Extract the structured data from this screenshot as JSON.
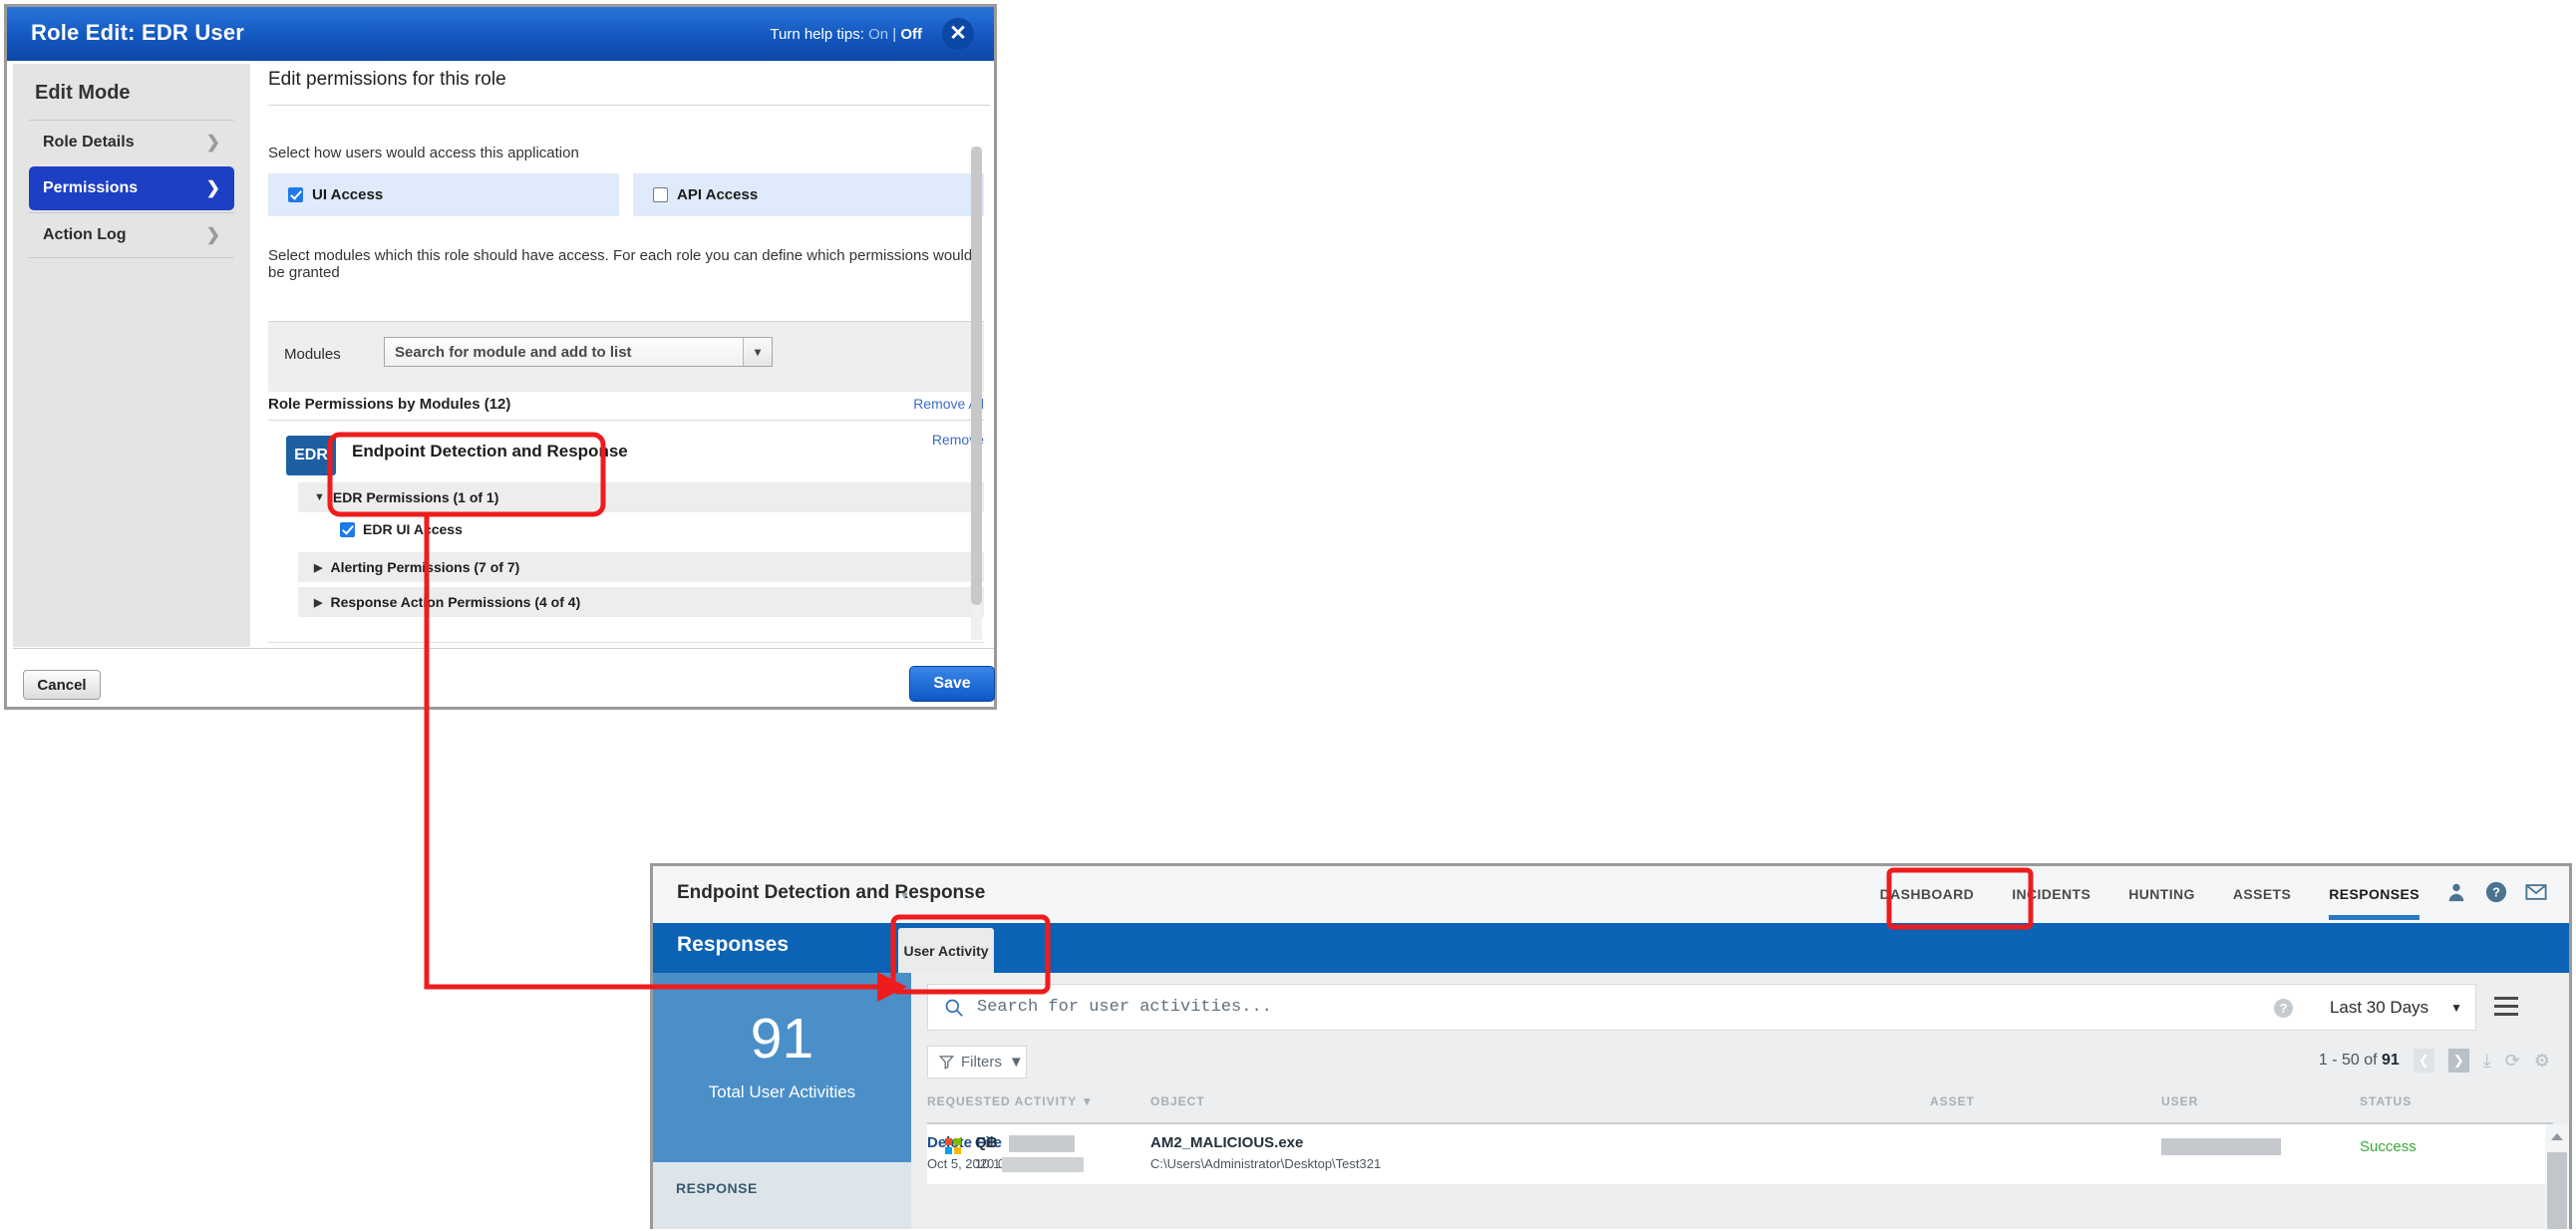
{
  "role_window": {
    "title": "Role Edit: EDR User",
    "help_tips": {
      "label": "Turn help tips:",
      "on": "On",
      "separator": "|",
      "off": "Off"
    },
    "close_icon": "close-icon",
    "sidebar": {
      "heading": "Edit Mode",
      "items": [
        {
          "label": "Role Details",
          "active": false
        },
        {
          "label": "Permissions",
          "active": true
        },
        {
          "label": "Action Log",
          "active": false
        }
      ]
    },
    "content": {
      "heading": "Edit permissions for this role",
      "access_prompt": "Select how users would access this application",
      "access_options": [
        {
          "label": "UI Access",
          "checked": true
        },
        {
          "label": "API Access",
          "checked": false
        }
      ],
      "modules_prompt": "Select modules which this role should have access. For each role you can define which permissions would be granted",
      "modules_label": "Modules",
      "modules_select_value": "Search for module and add to list",
      "role_permissions_title": "Role Permissions by Modules (12)",
      "remove_all_label": "Remove All",
      "module_card": {
        "badge": "EDR",
        "name": "Endpoint Detection and Response",
        "remove_label": "Remove",
        "groups": [
          {
            "label": "EDR Permissions (1 of 1)",
            "expanded": true,
            "caret": "▼"
          },
          {
            "label": "Alerting Permissions (7 of 7)",
            "expanded": false,
            "caret": "▶"
          },
          {
            "label": "Response Action Permissions (4 of 4)",
            "expanded": false,
            "caret": "▶"
          }
        ],
        "permissions": [
          {
            "label": "EDR UI Access",
            "checked": true
          }
        ]
      }
    },
    "footer": {
      "cancel_label": "Cancel",
      "save_label": "Save"
    }
  },
  "edr_window": {
    "app_name": "Endpoint Detection and Response",
    "nav": [
      {
        "label": "DASHBOARD",
        "active": false
      },
      {
        "label": "INCIDENTS",
        "active": false
      },
      {
        "label": "HUNTING",
        "active": false
      },
      {
        "label": "ASSETS",
        "active": false
      },
      {
        "label": "RESPONSES",
        "active": true
      }
    ],
    "header_icons": [
      "user-icon",
      "help-icon",
      "mail-icon"
    ],
    "page_title": "Responses",
    "tabs": [
      {
        "label": "User Activity",
        "active": true
      }
    ],
    "stat_card": {
      "value": "91",
      "caption": "Total User Activities"
    },
    "side_section_label": "RESPONSE",
    "search": {
      "placeholder": "Search for user activities...",
      "icon": "search-icon"
    },
    "help_icon": "help-circle-icon",
    "date_range": {
      "value": "Last 30 Days",
      "caret": "▼"
    },
    "menu_icon": "hamburger-icon",
    "filters": {
      "label": "Filters",
      "caret": "▼",
      "icon": "funnel-icon"
    },
    "pagination": {
      "range_prefix": "1 - 50 of",
      "total": "91",
      "prev_icon": "chevron-left-icon",
      "next_icon": "chevron-right-icon",
      "download_icon": "download-icon",
      "refresh_icon": "refresh-icon",
      "settings_icon": "gear-icon"
    },
    "table": {
      "columns": [
        {
          "label": "REQUESTED ACTIVITY",
          "sorted": true,
          "caret": "▼"
        },
        {
          "label": "OBJECT",
          "sorted": false
        },
        {
          "label": "ASSET",
          "sorted": false
        },
        {
          "label": "USER",
          "sorted": false
        },
        {
          "label": "STATUS",
          "sorted": false
        }
      ],
      "rows": [
        {
          "activity": "Delete File",
          "timestamp": "Oct 5, 2020 02:42 PM",
          "object": "AM2_MALICIOUS.exe",
          "object_path": "C:\\Users\\Administrator\\Desktop\\Test321",
          "asset": "QB",
          "asset_ip": "10.1",
          "asset_redacted": true,
          "user": "",
          "user_redacted": true,
          "status": "Success",
          "os_icon": "windows-icon"
        }
      ]
    }
  },
  "annotations": {
    "color": "#ee1c1c",
    "highlights": [
      "edr-permissions-group-box",
      "responses-tab-box",
      "user-activity-tab-box"
    ],
    "connector": "arrow from EDR permissions box to User Activity tab"
  }
}
